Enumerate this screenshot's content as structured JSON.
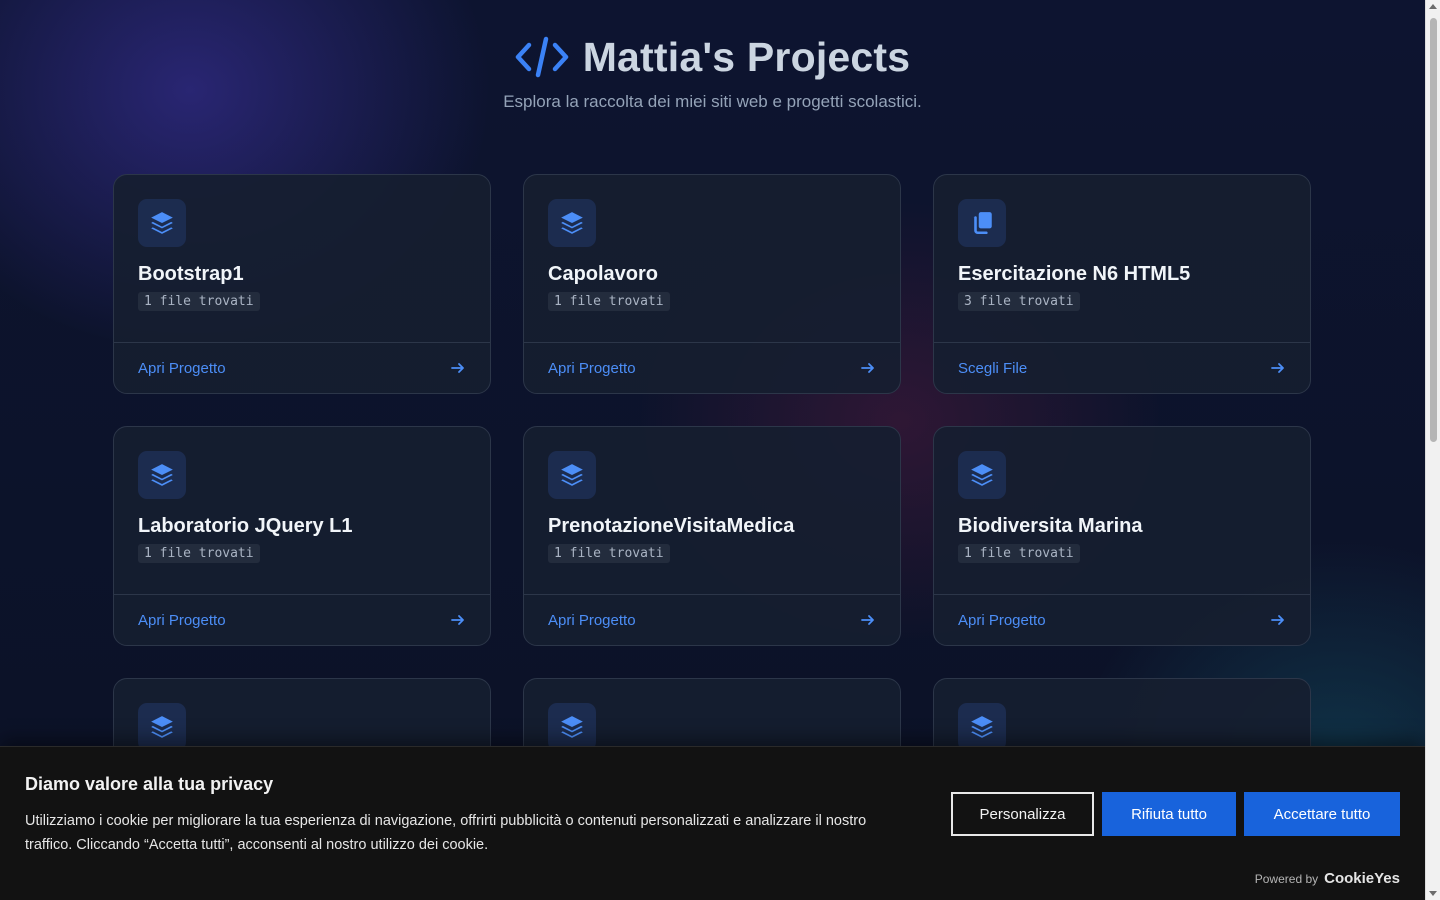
{
  "header": {
    "title": "Mattia's Projects",
    "subtitle": "Esplora la raccolta dei miei siti web e progetti scolastici."
  },
  "projects": [
    {
      "title": "Bootstrap1",
      "count": "1 file trovati",
      "link": "Apri Progetto",
      "icon": "layers-icon"
    },
    {
      "title": "Capolavoro",
      "count": "1 file trovati",
      "link": "Apri Progetto",
      "icon": "layers-icon"
    },
    {
      "title": "Esercitazione N6 HTML5",
      "count": "3 file trovati",
      "link": "Scegli File",
      "icon": "copy-icon"
    },
    {
      "title": "Laboratorio JQuery L1",
      "count": "1 file trovati",
      "link": "Apri Progetto",
      "icon": "layers-icon"
    },
    {
      "title": "PrenotazioneVisitaMedica",
      "count": "1 file trovati",
      "link": "Apri Progetto",
      "icon": "layers-icon"
    },
    {
      "title": "Biodiversita Marina",
      "count": "1 file trovati",
      "link": "Apri Progetto",
      "icon": "layers-icon"
    },
    {
      "title": "",
      "count": "",
      "link": "",
      "icon": "layers-icon"
    },
    {
      "title": "",
      "count": "",
      "link": "",
      "icon": "layers-icon"
    },
    {
      "title": "",
      "count": "",
      "link": "",
      "icon": "layers-icon"
    }
  ],
  "cookie_banner": {
    "title": "Diamo valore alla tua privacy",
    "text": "Utilizziamo i cookie per migliorare la tua esperienza di navigazione, offrirti pubblicità o contenuti personalizzati e analizzare il nostro traffico. Cliccando “Accetta tutti”, acconsenti al nostro utilizzo dei cookie.",
    "customize_label": "Personalizza",
    "reject_label": "Rifiuta tutto",
    "accept_label": "Accettare tutto",
    "powered_label": "Powered by",
    "powered_brand": "CookieYes"
  },
  "colors": {
    "accent": "#4c8ef7",
    "button_blue": "#1863dc",
    "background": "#0b1124"
  }
}
